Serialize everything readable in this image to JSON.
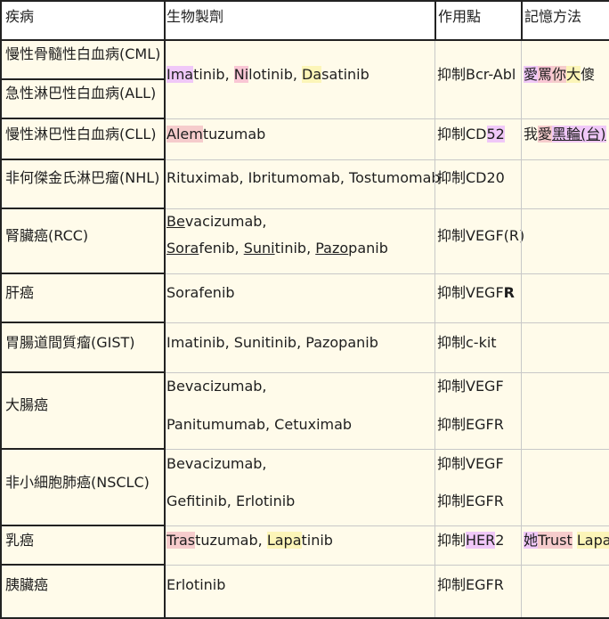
{
  "headers": {
    "disease": "疾病",
    "biologic": "生物製劑",
    "action": "作用點",
    "memory": "記憶方法"
  },
  "rows": {
    "cml": {
      "disease": "慢性骨髓性白血病(CML)"
    },
    "all": {
      "disease": "急性淋巴性白血病(ALL)"
    },
    "cml_all": {
      "drug1a": "Ima",
      "drug1b": "tinib, ",
      "drug2a": "Ni",
      "drug2b": "lotinib, ",
      "drug3a": "Da",
      "drug3b": "satinib",
      "action": "抑制Bcr-Abl",
      "mem1": "愛",
      "mem2": "罵",
      "mem3": "你",
      "mem4": "大",
      "mem5": "傻"
    },
    "cll": {
      "disease": "慢性淋巴性白血病(CLL)",
      "drug_a": "Alem",
      "drug_b": "tuzumab",
      "action_a": "抑制CD",
      "action_b": "52",
      "mem_a": "我",
      "mem_b": "愛",
      "mem_c": "黑輪",
      "mem_d": "(台)"
    },
    "nhl": {
      "disease": "非何傑金氏淋巴瘤(NHL)",
      "drug": "Rituximab, Ibritumomab, Tostumomab",
      "action": "抑制CD20"
    },
    "rcc": {
      "disease": "腎臟癌(RCC)",
      "line1a": "Be",
      "line1b": "vacizumab,",
      "line2a": "Sora",
      "line2b": "fenib, ",
      "line2c": "Suni",
      "line2d": "tinib, ",
      "line2e": "Pazo",
      "line2f": "panib",
      "action": "抑制VEGF(R)"
    },
    "liver": {
      "disease": "肝癌",
      "drug": "Sorafenib",
      "action_a": "抑制VEGF",
      "action_b": "R"
    },
    "gist": {
      "disease": "胃腸道間質瘤(GIST)",
      "drug": "Imatinib, Sunitinib, Pazopanib",
      "action": "抑制c-kit"
    },
    "colon": {
      "disease": "大腸癌",
      "drug1": "Bevacizumab,",
      "drug2": "Panitumumab, Cetuximab",
      "action1": "抑制VEGF",
      "action2": "抑制EGFR"
    },
    "nsclc": {
      "disease": "非小細胞肺癌(NSCLC)",
      "drug1": "Bevacizumab,",
      "drug2": "Gefitinib, Erlotinib",
      "action1": "抑制VEGF",
      "action2": "抑制EGFR"
    },
    "breast": {
      "disease": "乳癌",
      "drug_a": "Tras",
      "drug_b": "tuzumab, ",
      "drug_c": "Lapa",
      "drug_d": "tinib",
      "action_a": "抑制",
      "action_b": "HER",
      "action_c": "2",
      "mem_a": "她",
      "mem_b": "Trust",
      "mem_c": " ",
      "mem_d": "Lapa"
    },
    "pancreas": {
      "disease": "胰臟癌",
      "drug": "Erlotinib",
      "action": "抑制EGFR"
    }
  }
}
